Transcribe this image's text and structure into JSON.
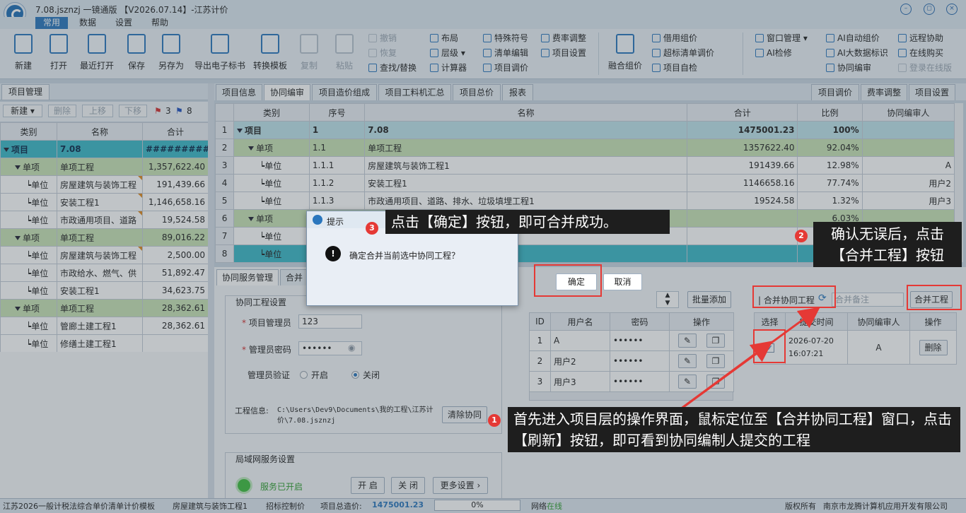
{
  "app": {
    "title": "7.08.jsznzj 一镜通版 【V2026.07.14】-江苏计价"
  },
  "menu": {
    "tabs": [
      "常用",
      "数据",
      "设置",
      "帮助"
    ]
  },
  "ribbon": {
    "large": [
      "新建",
      "打开",
      "最近打开",
      "保存",
      "另存为",
      "导出电子标书",
      "转换模板",
      "复制",
      "粘贴"
    ],
    "edit": [
      "撤销",
      "恢复",
      "查找/替换"
    ],
    "layout": [
      "布局",
      "层级",
      "计算器"
    ],
    "symbols": [
      "特殊符号",
      "清单编辑",
      "项目调价"
    ],
    "fees": [
      "费率调整",
      "项目设置"
    ],
    "merge": "融合组价",
    "combo": [
      "借用组价",
      "超标清单调价",
      "项目自检"
    ],
    "window": [
      "窗口管理",
      "AI检修"
    ],
    "ai": [
      "AI自动组价",
      "AI大数据标识",
      "协同编审"
    ],
    "remote": [
      "远程协助",
      "在线购买",
      "登录在线版"
    ]
  },
  "left": {
    "tab": "项目管理",
    "tools": {
      "new": "新建",
      "delete": "删除",
      "up": "上移",
      "down": "下移",
      "flag_red": "3",
      "flag_blue": "8"
    },
    "headers": [
      "类别",
      "名称",
      "合计"
    ],
    "rows": [
      {
        "type": "项目",
        "name": "7.08",
        "total": "###########",
        "style": "rteal",
        "depth": 0
      },
      {
        "type": "单项",
        "name": "单项工程",
        "total": "1,357,622.40",
        "style": "rgreen",
        "depth": 1
      },
      {
        "type": "单位",
        "name": "房屋建筑与装饰工程",
        "total": "191,439.66",
        "style": "rwhite",
        "depth": 2,
        "mark": true
      },
      {
        "type": "单位",
        "name": "安装工程1",
        "total": "1,146,658.16",
        "style": "rwhite",
        "depth": 2,
        "mark": true
      },
      {
        "type": "单位",
        "name": "市政通用项目、道路",
        "total": "19,524.58",
        "style": "rwhite",
        "depth": 2,
        "mark": true
      },
      {
        "type": "单项",
        "name": "单项工程",
        "total": "89,016.22",
        "style": "rgreen",
        "depth": 1
      },
      {
        "type": "单位",
        "name": "房屋建筑与装饰工程",
        "total": "2,500.00",
        "style": "rwhite",
        "depth": 2,
        "mark": true
      },
      {
        "type": "单位",
        "name": "市政给水、燃气、供",
        "total": "51,892.47",
        "style": "rwhite",
        "depth": 2
      },
      {
        "type": "单位",
        "name": "安装工程1",
        "total": "34,623.75",
        "style": "rwhite",
        "depth": 2
      },
      {
        "type": "单项",
        "name": "单项工程",
        "total": "28,362.61",
        "style": "rgreen",
        "depth": 1
      },
      {
        "type": "单位",
        "name": "管廊土建工程1",
        "total": "28,362.61",
        "style": "rwhite",
        "depth": 2
      },
      {
        "type": "单位",
        "name": "修缮土建工程1",
        "total": "",
        "style": "rwhite",
        "depth": 2
      }
    ]
  },
  "right": {
    "tabs": [
      "项目信息",
      "协同编审",
      "项目造价组成",
      "项目工料机汇总",
      "项目总价",
      "报表"
    ],
    "tabs_right": [
      "项目调价",
      "费率调整",
      "项目设置"
    ],
    "headers": [
      "类别",
      "序号",
      "名称",
      "合计",
      "比例",
      "协同编审人"
    ],
    "rows": [
      {
        "n": "1",
        "type": "项目",
        "code": "1",
        "name": "7.08",
        "total": "1475001.23",
        "ratio": "100%",
        "user": "",
        "style": "rlteal",
        "depth": 0
      },
      {
        "n": "2",
        "type": "单项",
        "code": "1.1",
        "name": "单项工程",
        "total": "1357622.40",
        "ratio": "92.04%",
        "user": "",
        "style": "rgreen",
        "depth": 1
      },
      {
        "n": "3",
        "type": "单位",
        "code": "1.1.1",
        "name": "房屋建筑与装饰工程1",
        "total": "191439.66",
        "ratio": "12.98%",
        "user": "A",
        "style": "rwhite",
        "depth": 2
      },
      {
        "n": "4",
        "type": "单位",
        "code": "1.1.2",
        "name": "安装工程1",
        "total": "1146658.16",
        "ratio": "77.74%",
        "user": "用户2",
        "style": "rwhite",
        "depth": 2
      },
      {
        "n": "5",
        "type": "单位",
        "code": "1.1.3",
        "name": "市政通用项目、道路、排水、垃圾填埋工程1",
        "total": "19524.58",
        "ratio": "1.32%",
        "user": "用户3",
        "style": "rwhite",
        "depth": 2
      },
      {
        "n": "6",
        "type": "单项",
        "code": "1.2",
        "name": "",
        "total": "",
        "ratio": "6.03%",
        "user": "",
        "style": "rgreen",
        "depth": 1
      },
      {
        "n": "7",
        "type": "单位",
        "code": "1.2.",
        "name": "",
        "total": "",
        "ratio": "0.17%",
        "user": "A",
        "style": "rwhite",
        "depth": 2
      },
      {
        "n": "8",
        "type": "单位",
        "code": "1.2.",
        "name": "",
        "total": "",
        "ratio": "3.52%",
        "user": "用户2",
        "style": "rteal2",
        "depth": 2
      }
    ]
  },
  "service": {
    "tabs": [
      "协同服务管理",
      "合并"
    ],
    "section": "协同工程设置",
    "manager_label": "项目管理员",
    "manager_value": "123",
    "password_label": "管理员密码",
    "password_value": "••••••",
    "verify_label": "管理员验证",
    "verify_on": "开启",
    "verify_off": "关闭",
    "project_info_label": "工程信息:",
    "project_path": "C:\\Users\\Dev9\\Documents\\我的工程\\江苏计价\\7.08.jsznzj",
    "clear_button": "清除协同",
    "lan_section": "局域网服务设置",
    "lan_status": "服务已开启",
    "lan_start": "开 启",
    "lan_stop": "关 闭",
    "lan_more": "更多设置"
  },
  "users": {
    "batch_add": "批量添加",
    "headers": [
      "ID",
      "用户名",
      "密码",
      "操作"
    ],
    "rows": [
      {
        "id": "1",
        "name": "A",
        "pwd": "••••••"
      },
      {
        "id": "2",
        "name": "用户2",
        "pwd": "••••••"
      },
      {
        "id": "3",
        "name": "用户3",
        "pwd": "••••••"
      }
    ]
  },
  "merge": {
    "window_label": "合并协同工程",
    "note_placeholder": "合并备注",
    "merge_button": "合并工程",
    "headers": [
      "选择",
      "提交时间",
      "协同编审人",
      "操作"
    ],
    "rows": [
      {
        "time": "2026-07-20 16:07:21",
        "user": "A",
        "action": "删除"
      }
    ]
  },
  "dialog": {
    "title": "提示",
    "message": "确定合并当前选中协同工程？",
    "ok": "确定",
    "cancel": "取消"
  },
  "callouts": [
    {
      "n": "1",
      "text": "首先进入项目层的操作界面，鼠标定位至【合并协同工程】窗口，点击【刷新】按钮，即可看到协同编制人提交的工程"
    },
    {
      "n": "2",
      "text": "确认无误后，点击【合并工程】按钮"
    },
    {
      "n": "3",
      "text": "点击【确定】按钮，即可合并成功。"
    }
  ],
  "status": {
    "template": "江苏2026一般计税法综合单价清单计价模板",
    "current": "房屋建筑与装饰工程1",
    "control": "招标控制价",
    "total_label": "项目总造价:",
    "total_value": "1475001.23",
    "progress": "0%",
    "network_label": "网络",
    "network_value": "在线",
    "copyright": "版权所有",
    "company": "南京市龙腾计算机应用开发有限公司"
  },
  "colors": {
    "accent": "#2a76bd",
    "teal": "#3bb8c8",
    "green": "#c9e3b5",
    "callout_red": "#e53935"
  }
}
